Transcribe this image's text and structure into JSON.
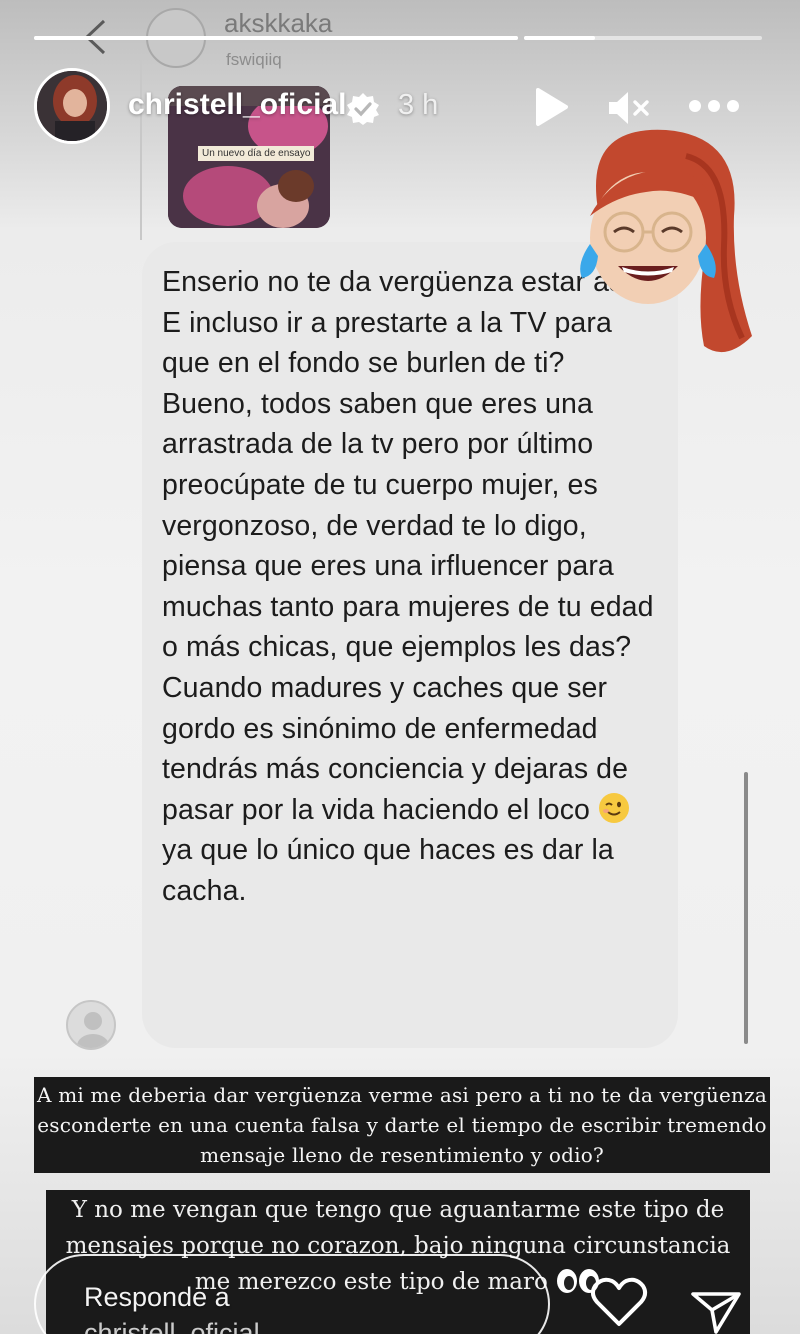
{
  "dm": {
    "username": "akskkaka",
    "subname": "fswiqiiq"
  },
  "story": {
    "progress": [
      1.0,
      0.3
    ],
    "username": "christell_oficial",
    "time": "3 h"
  },
  "reel": {
    "caption": "Un nuevo día de ensayo"
  },
  "message": {
    "text_before_emoji": "Enserio no te da vergüenza estar así? E incluso ir a prestarte a la TV para que en el fondo se burlen de ti? Bueno, todos saben que eres una arrastrada de la tv pero por último preocúpate de tu cuerpo mujer, es vergonzoso, de verdad te lo digo, piensa que eres una irfluencer para muchas tanto para mujeres de tu edad o más chicas, que ejemplos les das? Cuando madures y caches que ser gordo es sinónimo de enfermedad tendrás más conciencia y dejaras de pasar por la vida haciendo el loco",
    "emoji": "winking-face",
    "text_after_emoji": "ya que lo único que haces es dar la cacha."
  },
  "overlays": {
    "first": "A mi me deberia dar vergüenza verme asi pero a ti no te da vergüenza esconderte en una cuenta falsa y darte el tiempo de escribir tremendo mensaje lleno de resentimiento y odio?",
    "second": "Y no me vengan que tengo que aguantarme este tipo de mensajes porque no corazon, bajo ninguna circunstancia me merezco este tipo de maro"
  },
  "reply": {
    "placeholder": "Responde a",
    "placeholder_cont": "christell_oficial"
  },
  "icons": {
    "back": "chevron-left-icon",
    "verified": "verified-badge-icon",
    "play": "play-icon",
    "mute": "speaker-muted-icon",
    "more": "more-dots-icon",
    "heart": "heart-icon",
    "send": "send-icon",
    "sticker": "crying-laughing-memoji",
    "eyes": "eyes-emoji"
  },
  "colors": {
    "bubble": "#e9e9e9",
    "overlay_bg": "#1a1a1a",
    "verified": "#ffffff"
  }
}
